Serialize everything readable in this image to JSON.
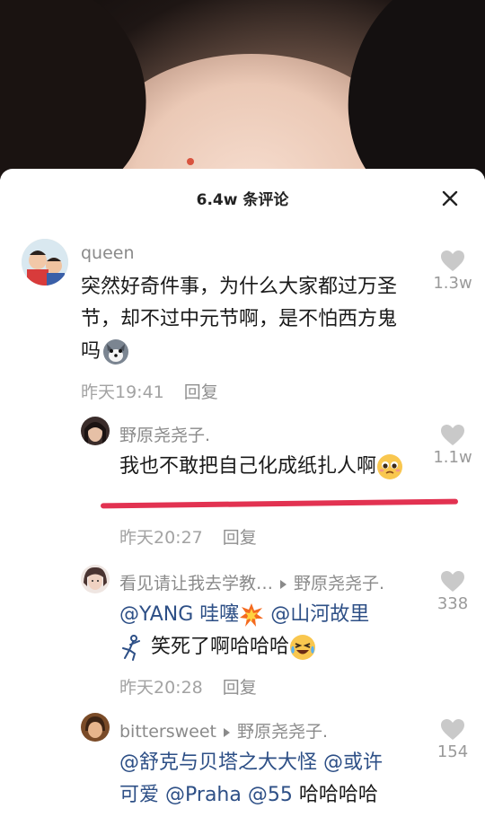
{
  "sheet": {
    "title": "6.4w 条评论"
  },
  "comments": [
    {
      "user": "queen",
      "text": "突然好奇件事，为什么大家都过万圣节，却不过中元节啊，是不怕西方鬼吗",
      "time": "昨天19:41",
      "reply_label": "回复",
      "likes": "1.3w"
    },
    {
      "user": "野原尧尧子.",
      "text": "我也不敢把自己化成纸扎人啊",
      "time": "昨天20:27",
      "reply_label": "回复",
      "likes": "1.1w"
    },
    {
      "user": "看见请让我去学教…",
      "reply_to": "野原尧尧子.",
      "mention1": "@YANG 哇噻",
      "mention2": "@山河故里",
      "text": "笑死了啊哈哈哈",
      "time": "昨天20:28",
      "reply_label": "回复",
      "likes": "338"
    },
    {
      "user": "bittersweet",
      "reply_to": "野原尧尧子.",
      "mention1": "@舒克与贝塔之大大怪",
      "mention2": "@或许",
      "mention3": "可爱",
      "mention4": "@Praha",
      "mention5": "@55",
      "text": "哈哈哈哈",
      "likes": "154"
    }
  ],
  "colors": {
    "highlight_underline": "#e23251",
    "mention": "#2d4f86"
  }
}
